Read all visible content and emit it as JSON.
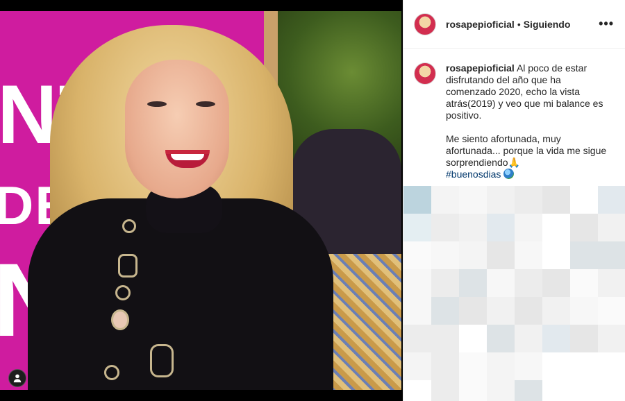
{
  "post": {
    "username": "rosapepioficial",
    "separator": "•",
    "follow_status": "Siguiendo",
    "more_label": "•••",
    "caption_line1": "Al poco de estar disfrutando del año que ha comenzado 2020, echo la vista atrás(2019) y veo que mi balance es positivo.",
    "caption_line2": "Me siento afortunada, muy afortunada... porque la vida me sigue sorprendiendo",
    "pray_emoji": "🙏",
    "hashtag": "#buenosdias"
  },
  "photo": {
    "banner_letters": [
      "NTR",
      "DEL",
      "N"
    ]
  },
  "colors": {
    "banner": "#cf1c9f",
    "hashtag": "#00376b",
    "text": "#262626"
  },
  "icons": {
    "more": "more-dots-icon",
    "tagged_user": "person-icon",
    "globe": "globe-icon"
  }
}
